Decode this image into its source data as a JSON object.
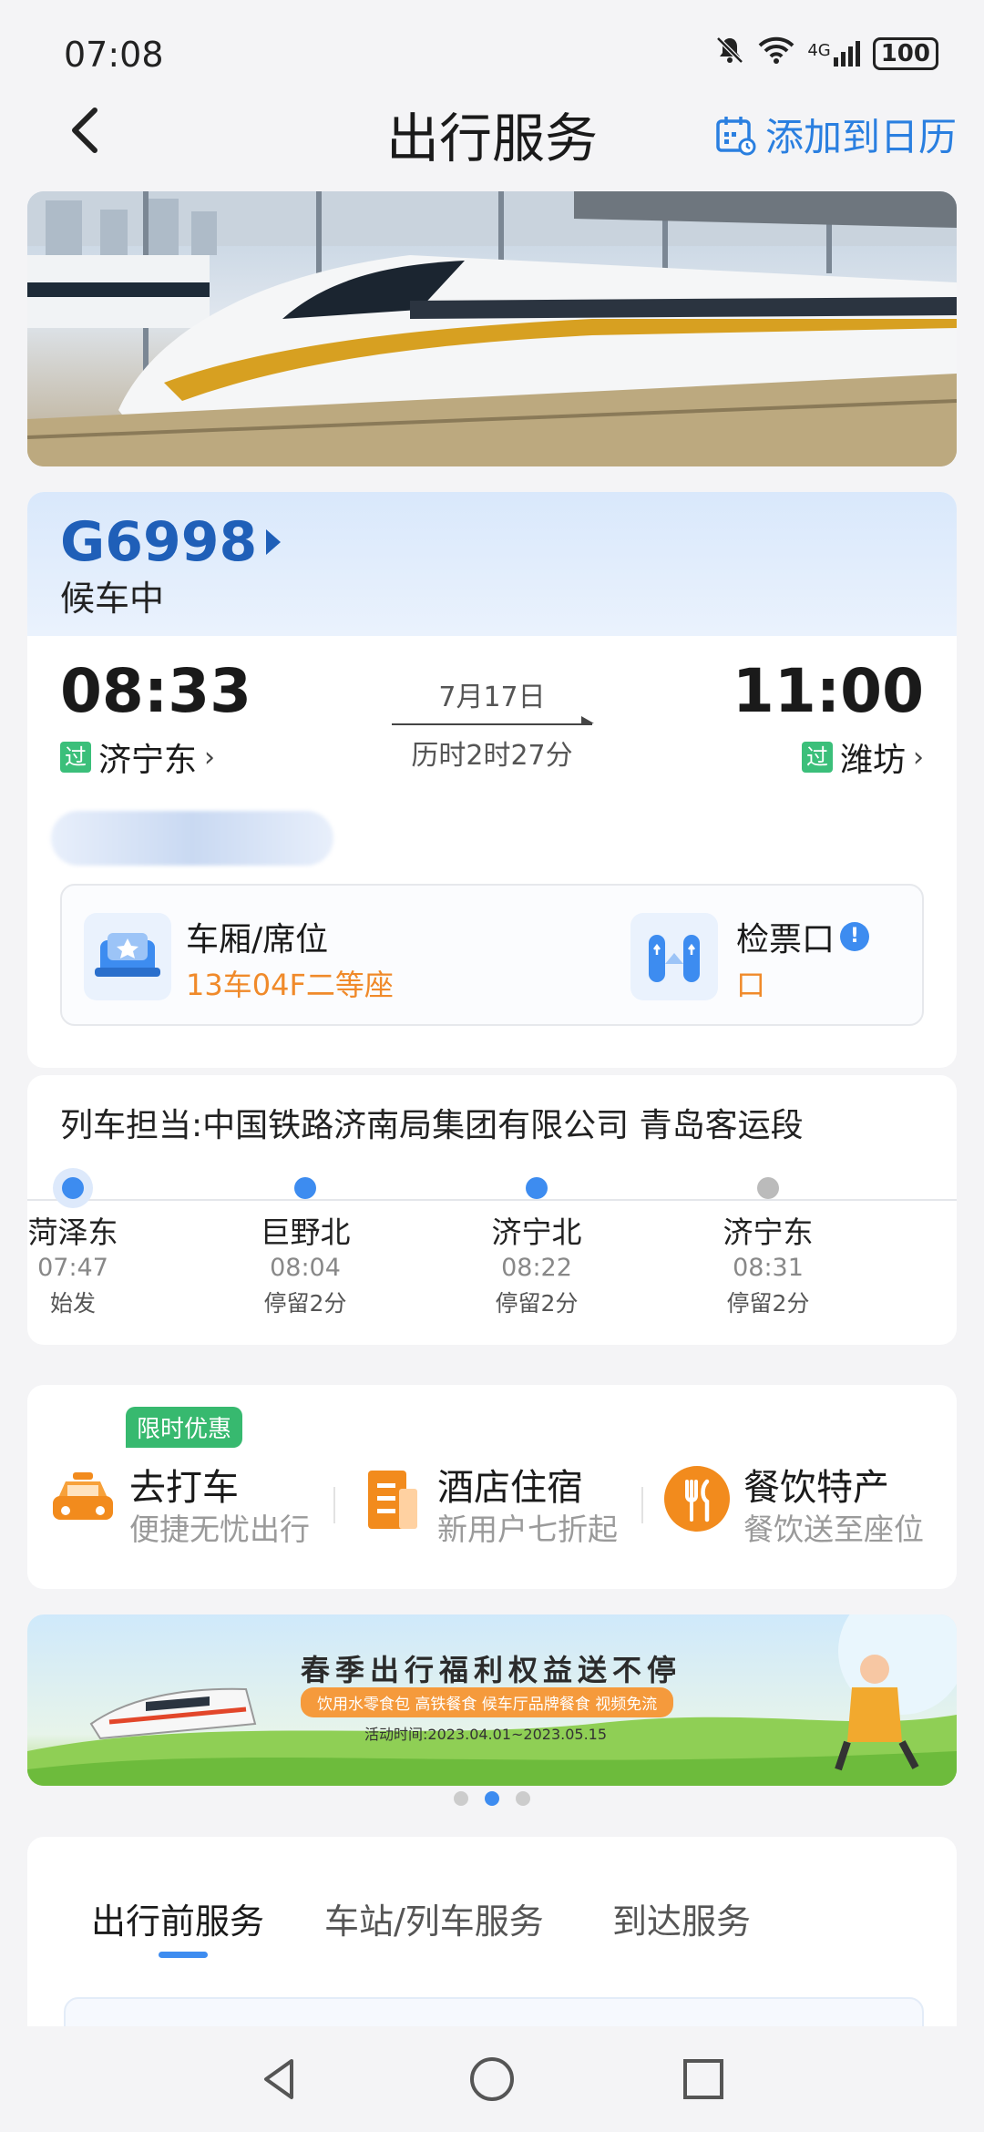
{
  "status_bar": {
    "time": "07:08",
    "network": "4G",
    "battery": "100"
  },
  "header": {
    "title": "出行服务",
    "calendar_label": "添加到日历"
  },
  "ticket": {
    "train_no": "G6998",
    "state": "候车中",
    "dep_time": "08:33",
    "dep_station": "济宁东",
    "arr_time": "11:00",
    "arr_station": "潍坊",
    "pass_tag": "过",
    "date": "7月17日",
    "duration": "历时2时27分",
    "seat_label": "车厢/席位",
    "seat_value": "13车04F二等座",
    "gate_label": "检票口",
    "gate_value": "口"
  },
  "route": {
    "operator": "列车担当:中国铁路济南局集团有限公司 青岛客运段",
    "stops": [
      {
        "name": "菏泽东",
        "time": "07:47",
        "stay": "始发"
      },
      {
        "name": "巨野北",
        "time": "08:04",
        "stay": "停留2分"
      },
      {
        "name": "济宁北",
        "time": "08:22",
        "stay": "停留2分"
      },
      {
        "name": "济宁东",
        "time": "08:31",
        "stay": "停留2分"
      }
    ]
  },
  "services": {
    "badge": "限时优惠",
    "items": [
      {
        "title": "去打车",
        "sub": "便捷无忧出行",
        "icon": "taxi-icon"
      },
      {
        "title": "酒店住宿",
        "sub": "新用户七折起",
        "icon": "hotel-icon"
      },
      {
        "title": "餐饮特产",
        "sub": "餐饮送至座位",
        "icon": "dining-icon"
      }
    ]
  },
  "banner": {
    "title": "春季出行福利权益送不停",
    "pill": "饮用水零食包 高铁餐食 候车厅品牌餐食 视频免流",
    "date": "活动时间:2023.04.01~2023.05.15",
    "page_index": 2,
    "page_count": 3
  },
  "tabs": {
    "items": [
      "出行前服务",
      "车站/列车服务",
      "到达服务"
    ],
    "active": 0
  },
  "colors": {
    "accent": "#3d8cf0",
    "train_blue": "#1f5fb8",
    "orange": "#f08a2a",
    "green": "#3bbf7a"
  }
}
